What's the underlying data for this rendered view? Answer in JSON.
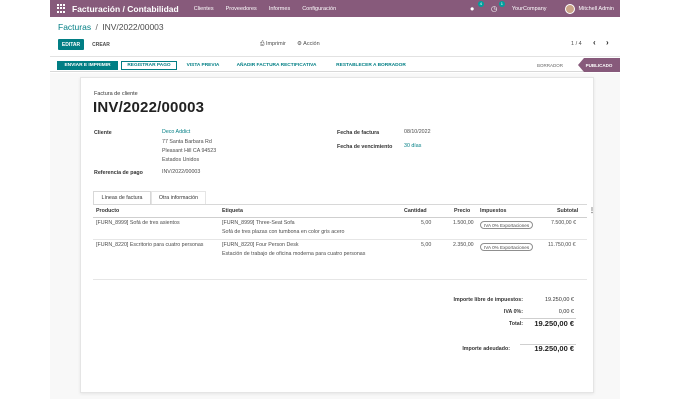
{
  "navbar": {
    "app_title": "Facturación / Contabilidad",
    "menu": [
      "Clientes",
      "Proveedores",
      "Informes",
      "Configuración"
    ],
    "chat_count": "4",
    "activity_count": "1",
    "company": "YourCompany",
    "user": "Mitchell Admin"
  },
  "breadcrumb": {
    "parent": "Facturas",
    "separator": "/",
    "current": "INV/2022/00003"
  },
  "controls": {
    "edit": "EDITAR",
    "create": "CREAR",
    "print": "Imprimir",
    "action": "Acción",
    "pager": "1 / 4"
  },
  "statusbar": {
    "send_print": "ENVIAR E IMPRIMIR",
    "register_payment": "REGISTRAR PAGO",
    "preview": "VISTA PREVIA",
    "credit_note": "AÑADIR FACTURA RECTIFICATIVA",
    "reset_draft": "RESTABLECER A BORRADOR",
    "stages": [
      "BORRADOR",
      "PUBLICADO"
    ]
  },
  "invoice": {
    "type_label": "Factura de cliente",
    "name": "INV/2022/00003",
    "customer_label": "Cliente",
    "customer_name": "Deco Addict",
    "address": [
      "77 Santa Barbara Rd",
      "Pleasant Hill CA 94523",
      "Estados Unidos"
    ],
    "payment_ref_label": "Referencia de pago",
    "payment_ref": "INV/2022/00003",
    "invoice_date_label": "Fecha de factura",
    "invoice_date": "08/10/2022",
    "due_date_label": "Fecha de vencimiento",
    "due_date": "30 días"
  },
  "tabs": [
    "Líneas de factura",
    "Otra información"
  ],
  "table": {
    "columns": [
      "Producto",
      "Etiqueta",
      "Cantidad",
      "Precio",
      "Impuestos",
      "Subtotal"
    ],
    "rows": [
      {
        "product": "[FURN_8999] Sofá de tres asientos",
        "label": "[FURN_8999] Three-Seat Sofa",
        "label2": "Sofá de tres plazas con tumbona en color gris acero",
        "qty": "5,00",
        "price": "1.500,00",
        "tax": "IVA 0% Exportaciones",
        "subtotal": "7.500,00 €"
      },
      {
        "product": "[FURN_8220] Escritorio para cuatro personas",
        "label": "[FURN_8220] Four Person Desk",
        "label2": "Estación de trabajo de oficina moderna para cuatro personas",
        "qty": "5,00",
        "price": "2.350,00",
        "tax": "IVA 0% Exportaciones",
        "subtotal": "11.750,00 €"
      }
    ]
  },
  "totals": {
    "untaxed_label": "Importe libre de impuestos:",
    "untaxed": "19.250,00 €",
    "tax_label": "IVA 0%:",
    "tax": "0,00 €",
    "total_label": "Total:",
    "total": "19.250,00 €",
    "due_label": "Importe adeudado:",
    "due": "19.250,00 €"
  },
  "colors": {
    "brand": "#875a7b",
    "accent": "#017e84"
  }
}
